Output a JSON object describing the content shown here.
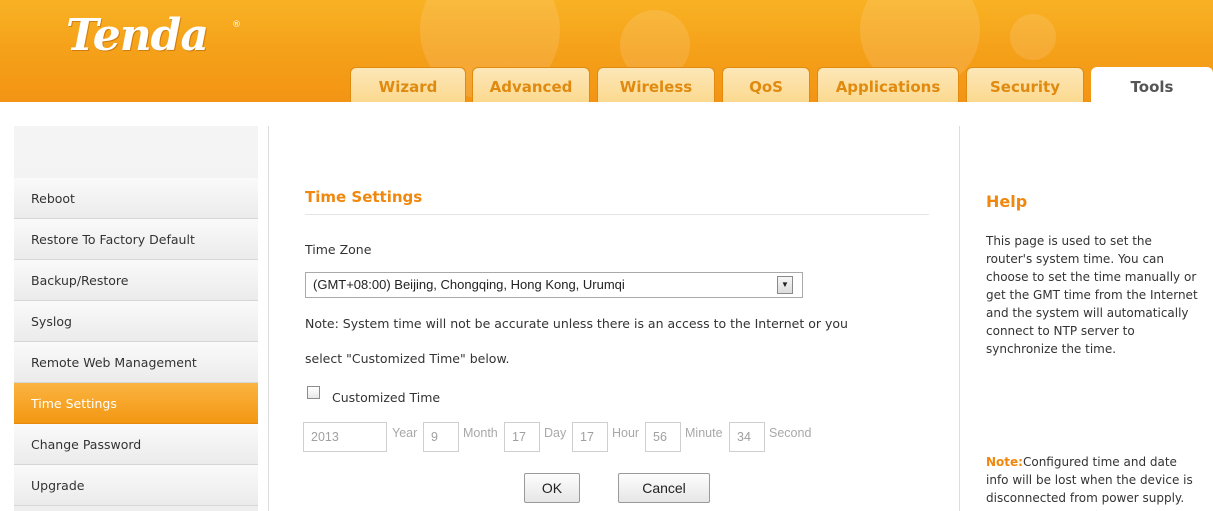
{
  "header": {
    "logo": "Tenda",
    "logo_mark": "®",
    "tabs": [
      {
        "label": "Wizard"
      },
      {
        "label": "Advanced"
      },
      {
        "label": "Wireless"
      },
      {
        "label": "QoS"
      },
      {
        "label": "Applications"
      },
      {
        "label": "Security"
      },
      {
        "label": "Tools",
        "active": true
      }
    ]
  },
  "sidebar": {
    "items": [
      {
        "label": "Reboot"
      },
      {
        "label": "Restore To Factory Default"
      },
      {
        "label": "Backup/Restore"
      },
      {
        "label": "Syslog"
      },
      {
        "label": "Remote Web Management"
      },
      {
        "label": "Time Settings",
        "active": true
      },
      {
        "label": "Change Password"
      },
      {
        "label": "Upgrade"
      }
    ]
  },
  "main": {
    "title": "Time Settings",
    "time_zone_label": "Time Zone",
    "time_zone_value": "(GMT+08:00) Beijing, Chongqing, Hong Kong, Urumqi",
    "note_line1": "Note: System time will not be accurate unless there is an access to the Internet or you",
    "note_line2": "select \"Customized Time\" below.",
    "customized_label": "Customized Time",
    "customized_checked": false,
    "fields": {
      "year": {
        "value": "2013",
        "unit": "Year"
      },
      "month": {
        "value": "9",
        "unit": "Month"
      },
      "day": {
        "value": "17",
        "unit": "Day"
      },
      "hour": {
        "value": "17",
        "unit": "Hour"
      },
      "minute": {
        "value": "56",
        "unit": "Minute"
      },
      "second": {
        "value": "34",
        "unit": "Second"
      }
    },
    "ok_label": "OK",
    "cancel_label": "Cancel"
  },
  "help": {
    "title": "Help",
    "body": "This page is used to set the router's system time. You can choose to set the time manually or get the GMT time from the Internet and the system will automatically connect to NTP server to synchronize the time.",
    "note_label": "Note:",
    "note_text": "Configured time and date info will be lost when the device is disconnected from power supply."
  },
  "colors": {
    "brand_orange": "#f39414",
    "accent_text": "#f0870e",
    "active_nav": "#f5a021"
  }
}
